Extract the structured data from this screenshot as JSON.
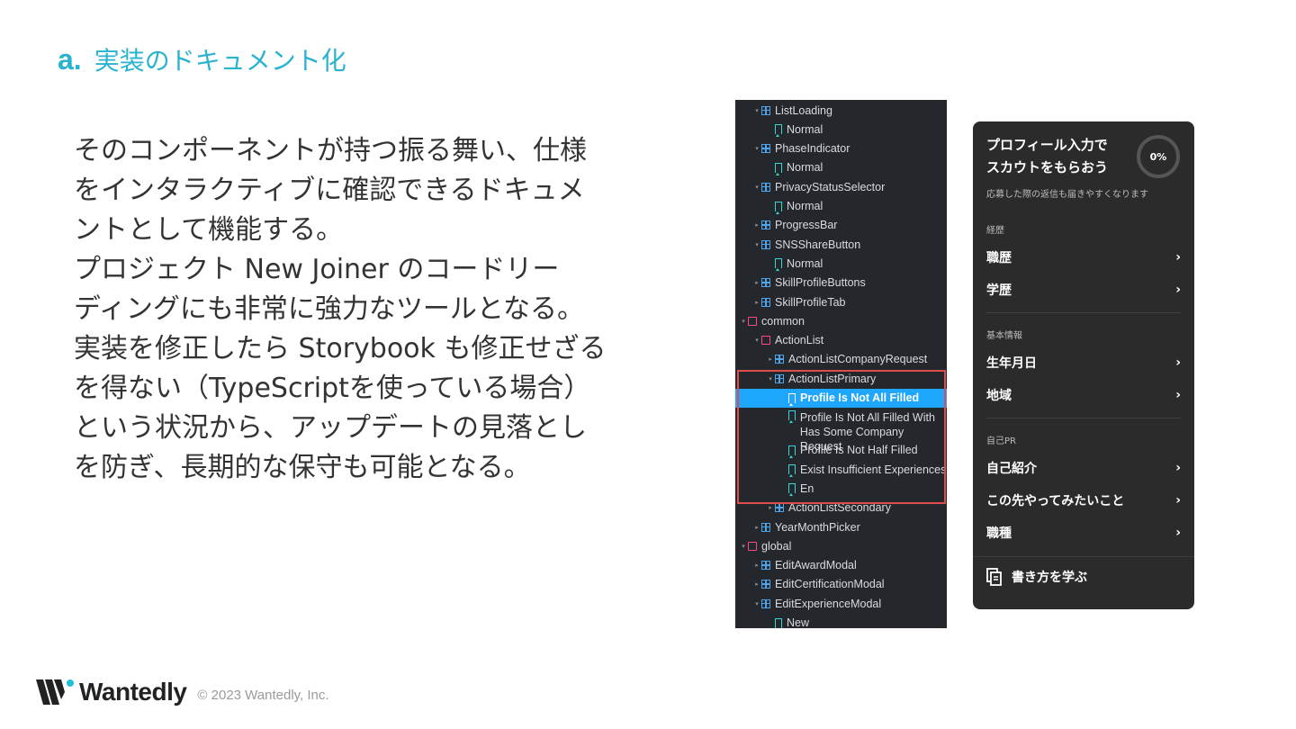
{
  "heading": {
    "letter": "a.",
    "title": "実装のドキュメント化"
  },
  "body_lines": [
    "そのコンポーネントが持つ振る舞い、仕様",
    "をインタラクティブに確認できるドキュメ",
    "ントとして機能する。",
    "プロジェクト New Joiner のコードリー",
    "ディングにも非常に強力なツールとなる。",
    "実装を修正したら Storybook も修正せざる",
    "を得ない（TypeScriptを使っている場合）",
    "という状況から、アップデートの見落とし",
    "を防ぎ、長期的な保守も可能となる。"
  ],
  "tree": [
    {
      "label": "ListLoading",
      "type": "component",
      "depth": 1,
      "arrow": "▾"
    },
    {
      "label": "Normal",
      "type": "story",
      "depth": 2
    },
    {
      "label": "PhaseIndicator",
      "type": "component",
      "depth": 1,
      "arrow": "▾"
    },
    {
      "label": "Normal",
      "type": "story",
      "depth": 2
    },
    {
      "label": "PrivacyStatusSelector",
      "type": "component",
      "depth": 1,
      "arrow": "▾"
    },
    {
      "label": "Normal",
      "type": "story",
      "depth": 2
    },
    {
      "label": "ProgressBar",
      "type": "component",
      "depth": 1,
      "arrow": "▸"
    },
    {
      "label": "SNSShareButton",
      "type": "component",
      "depth": 1,
      "arrow": "▾"
    },
    {
      "label": "Normal",
      "type": "story",
      "depth": 2
    },
    {
      "label": "SkillProfileButtons",
      "type": "component",
      "depth": 1,
      "arrow": "▸"
    },
    {
      "label": "SkillProfileTab",
      "type": "component",
      "depth": 1,
      "arrow": "▸"
    },
    {
      "label": "common",
      "type": "folder",
      "depth": 0,
      "arrow": "▾"
    },
    {
      "label": "ActionList",
      "type": "folder",
      "depth": 1,
      "arrow": "▾"
    },
    {
      "label": "ActionListCompanyRequest",
      "type": "component",
      "depth": 2,
      "arrow": "▸"
    },
    {
      "label": "ActionListPrimary",
      "type": "component",
      "depth": 2,
      "arrow": "▾"
    },
    {
      "label": "Profile Is Not All Filled",
      "type": "story",
      "depth": 3,
      "selected": true
    },
    {
      "label": "Profile Is Not All Filled With Has Some Company Request",
      "type": "story",
      "depth": 3,
      "two_line": true
    },
    {
      "label": "Profile Is Not Half Filled",
      "type": "story",
      "depth": 3
    },
    {
      "label": "Exist Insufficient Experiences",
      "type": "story",
      "depth": 3
    },
    {
      "label": "En",
      "type": "story",
      "depth": 3
    },
    {
      "label": "ActionListSecondary",
      "type": "component",
      "depth": 2,
      "arrow": "▸"
    },
    {
      "label": "YearMonthPicker",
      "type": "component",
      "depth": 1,
      "arrow": "▸"
    },
    {
      "label": "global",
      "type": "folder",
      "depth": 0,
      "arrow": "▾"
    },
    {
      "label": "EditAwardModal",
      "type": "component",
      "depth": 1,
      "arrow": "▸"
    },
    {
      "label": "EditCertificationModal",
      "type": "component",
      "depth": 1,
      "arrow": "▸"
    },
    {
      "label": "EditExperienceModal",
      "type": "component",
      "depth": 1,
      "arrow": "▾"
    },
    {
      "label": "New",
      "type": "story",
      "depth": 2
    }
  ],
  "card": {
    "title_line1": "プロフィール入力で",
    "title_line2": "スカウトをもらおう",
    "progress": "0%",
    "progress_value": 0,
    "subtitle": "応募した際の返信も届きやすくなります",
    "sections": [
      {
        "label": "経歴",
        "items": [
          "職歴",
          "学歴"
        ]
      },
      {
        "label": "基本情報",
        "items": [
          "生年月日",
          "地域"
        ]
      },
      {
        "label": "自己PR",
        "items": [
          "自己紹介",
          "この先やってみたいこと",
          "職種"
        ]
      }
    ],
    "chevron": "›",
    "footer_link": "書き方を学ぶ"
  },
  "footer": {
    "brand": "Wantedly",
    "copyright": "© 2023 Wantedly, Inc."
  },
  "colors": {
    "accent": "#29b3cf",
    "highlight": "#e04b4b",
    "selected": "#1ea7fd"
  }
}
